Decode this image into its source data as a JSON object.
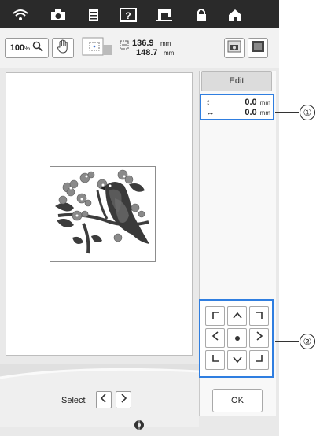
{
  "topbar": {
    "icons": [
      "wifi-icon",
      "camera-icon",
      "document-icon",
      "help-icon",
      "machine-icon",
      "lock-icon",
      "home-icon"
    ]
  },
  "toolbar": {
    "zoom_value": "100",
    "zoom_unit": "%",
    "size_width": "136.9",
    "size_height": "148.7",
    "size_unit": "mm"
  },
  "panel": {
    "edit_label": "Edit",
    "vertical_offset": "0.0",
    "horizontal_offset": "0.0",
    "offset_unit": "mm",
    "ok_label": "OK"
  },
  "footer": {
    "select_label": "Select"
  },
  "callouts": [
    "①",
    "②"
  ],
  "colors": {
    "accent_blue": "#2f7ee0",
    "topbar": "#2a2a2a"
  }
}
